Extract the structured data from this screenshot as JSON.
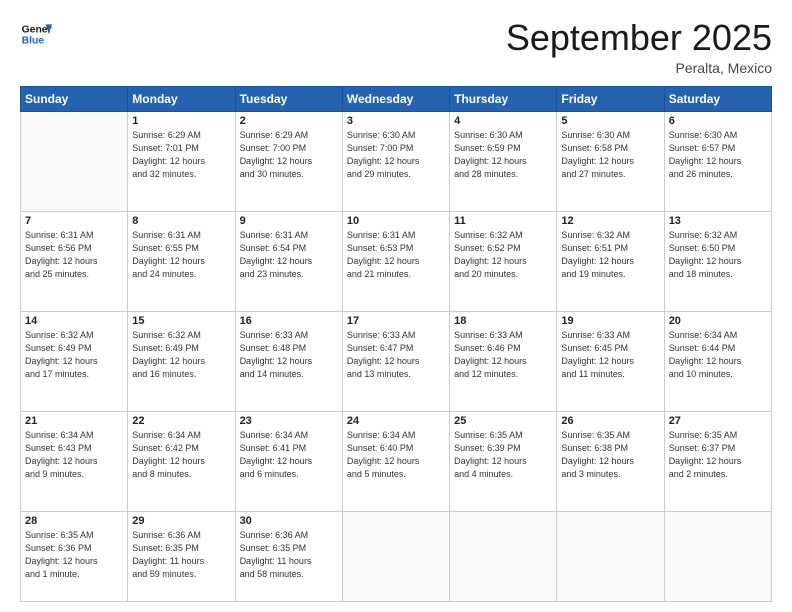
{
  "header": {
    "logo_line1": "General",
    "logo_line2": "Blue",
    "month": "September 2025",
    "location": "Peralta, Mexico"
  },
  "days_of_week": [
    "Sunday",
    "Monday",
    "Tuesday",
    "Wednesday",
    "Thursday",
    "Friday",
    "Saturday"
  ],
  "weeks": [
    [
      {
        "num": "",
        "info": ""
      },
      {
        "num": "1",
        "info": "Sunrise: 6:29 AM\nSunset: 7:01 PM\nDaylight: 12 hours\nand 32 minutes."
      },
      {
        "num": "2",
        "info": "Sunrise: 6:29 AM\nSunset: 7:00 PM\nDaylight: 12 hours\nand 30 minutes."
      },
      {
        "num": "3",
        "info": "Sunrise: 6:30 AM\nSunset: 7:00 PM\nDaylight: 12 hours\nand 29 minutes."
      },
      {
        "num": "4",
        "info": "Sunrise: 6:30 AM\nSunset: 6:59 PM\nDaylight: 12 hours\nand 28 minutes."
      },
      {
        "num": "5",
        "info": "Sunrise: 6:30 AM\nSunset: 6:58 PM\nDaylight: 12 hours\nand 27 minutes."
      },
      {
        "num": "6",
        "info": "Sunrise: 6:30 AM\nSunset: 6:57 PM\nDaylight: 12 hours\nand 26 minutes."
      }
    ],
    [
      {
        "num": "7",
        "info": "Sunrise: 6:31 AM\nSunset: 6:56 PM\nDaylight: 12 hours\nand 25 minutes."
      },
      {
        "num": "8",
        "info": "Sunrise: 6:31 AM\nSunset: 6:55 PM\nDaylight: 12 hours\nand 24 minutes."
      },
      {
        "num": "9",
        "info": "Sunrise: 6:31 AM\nSunset: 6:54 PM\nDaylight: 12 hours\nand 23 minutes."
      },
      {
        "num": "10",
        "info": "Sunrise: 6:31 AM\nSunset: 6:53 PM\nDaylight: 12 hours\nand 21 minutes."
      },
      {
        "num": "11",
        "info": "Sunrise: 6:32 AM\nSunset: 6:52 PM\nDaylight: 12 hours\nand 20 minutes."
      },
      {
        "num": "12",
        "info": "Sunrise: 6:32 AM\nSunset: 6:51 PM\nDaylight: 12 hours\nand 19 minutes."
      },
      {
        "num": "13",
        "info": "Sunrise: 6:32 AM\nSunset: 6:50 PM\nDaylight: 12 hours\nand 18 minutes."
      }
    ],
    [
      {
        "num": "14",
        "info": "Sunrise: 6:32 AM\nSunset: 6:49 PM\nDaylight: 12 hours\nand 17 minutes."
      },
      {
        "num": "15",
        "info": "Sunrise: 6:32 AM\nSunset: 6:49 PM\nDaylight: 12 hours\nand 16 minutes."
      },
      {
        "num": "16",
        "info": "Sunrise: 6:33 AM\nSunset: 6:48 PM\nDaylight: 12 hours\nand 14 minutes."
      },
      {
        "num": "17",
        "info": "Sunrise: 6:33 AM\nSunset: 6:47 PM\nDaylight: 12 hours\nand 13 minutes."
      },
      {
        "num": "18",
        "info": "Sunrise: 6:33 AM\nSunset: 6:46 PM\nDaylight: 12 hours\nand 12 minutes."
      },
      {
        "num": "19",
        "info": "Sunrise: 6:33 AM\nSunset: 6:45 PM\nDaylight: 12 hours\nand 11 minutes."
      },
      {
        "num": "20",
        "info": "Sunrise: 6:34 AM\nSunset: 6:44 PM\nDaylight: 12 hours\nand 10 minutes."
      }
    ],
    [
      {
        "num": "21",
        "info": "Sunrise: 6:34 AM\nSunset: 6:43 PM\nDaylight: 12 hours\nand 9 minutes."
      },
      {
        "num": "22",
        "info": "Sunrise: 6:34 AM\nSunset: 6:42 PM\nDaylight: 12 hours\nand 8 minutes."
      },
      {
        "num": "23",
        "info": "Sunrise: 6:34 AM\nSunset: 6:41 PM\nDaylight: 12 hours\nand 6 minutes."
      },
      {
        "num": "24",
        "info": "Sunrise: 6:34 AM\nSunset: 6:40 PM\nDaylight: 12 hours\nand 5 minutes."
      },
      {
        "num": "25",
        "info": "Sunrise: 6:35 AM\nSunset: 6:39 PM\nDaylight: 12 hours\nand 4 minutes."
      },
      {
        "num": "26",
        "info": "Sunrise: 6:35 AM\nSunset: 6:38 PM\nDaylight: 12 hours\nand 3 minutes."
      },
      {
        "num": "27",
        "info": "Sunrise: 6:35 AM\nSunset: 6:37 PM\nDaylight: 12 hours\nand 2 minutes."
      }
    ],
    [
      {
        "num": "28",
        "info": "Sunrise: 6:35 AM\nSunset: 6:36 PM\nDaylight: 12 hours\nand 1 minute."
      },
      {
        "num": "29",
        "info": "Sunrise: 6:36 AM\nSunset: 6:35 PM\nDaylight: 11 hours\nand 59 minutes."
      },
      {
        "num": "30",
        "info": "Sunrise: 6:36 AM\nSunset: 6:35 PM\nDaylight: 11 hours\nand 58 minutes."
      },
      {
        "num": "",
        "info": ""
      },
      {
        "num": "",
        "info": ""
      },
      {
        "num": "",
        "info": ""
      },
      {
        "num": "",
        "info": ""
      }
    ]
  ]
}
